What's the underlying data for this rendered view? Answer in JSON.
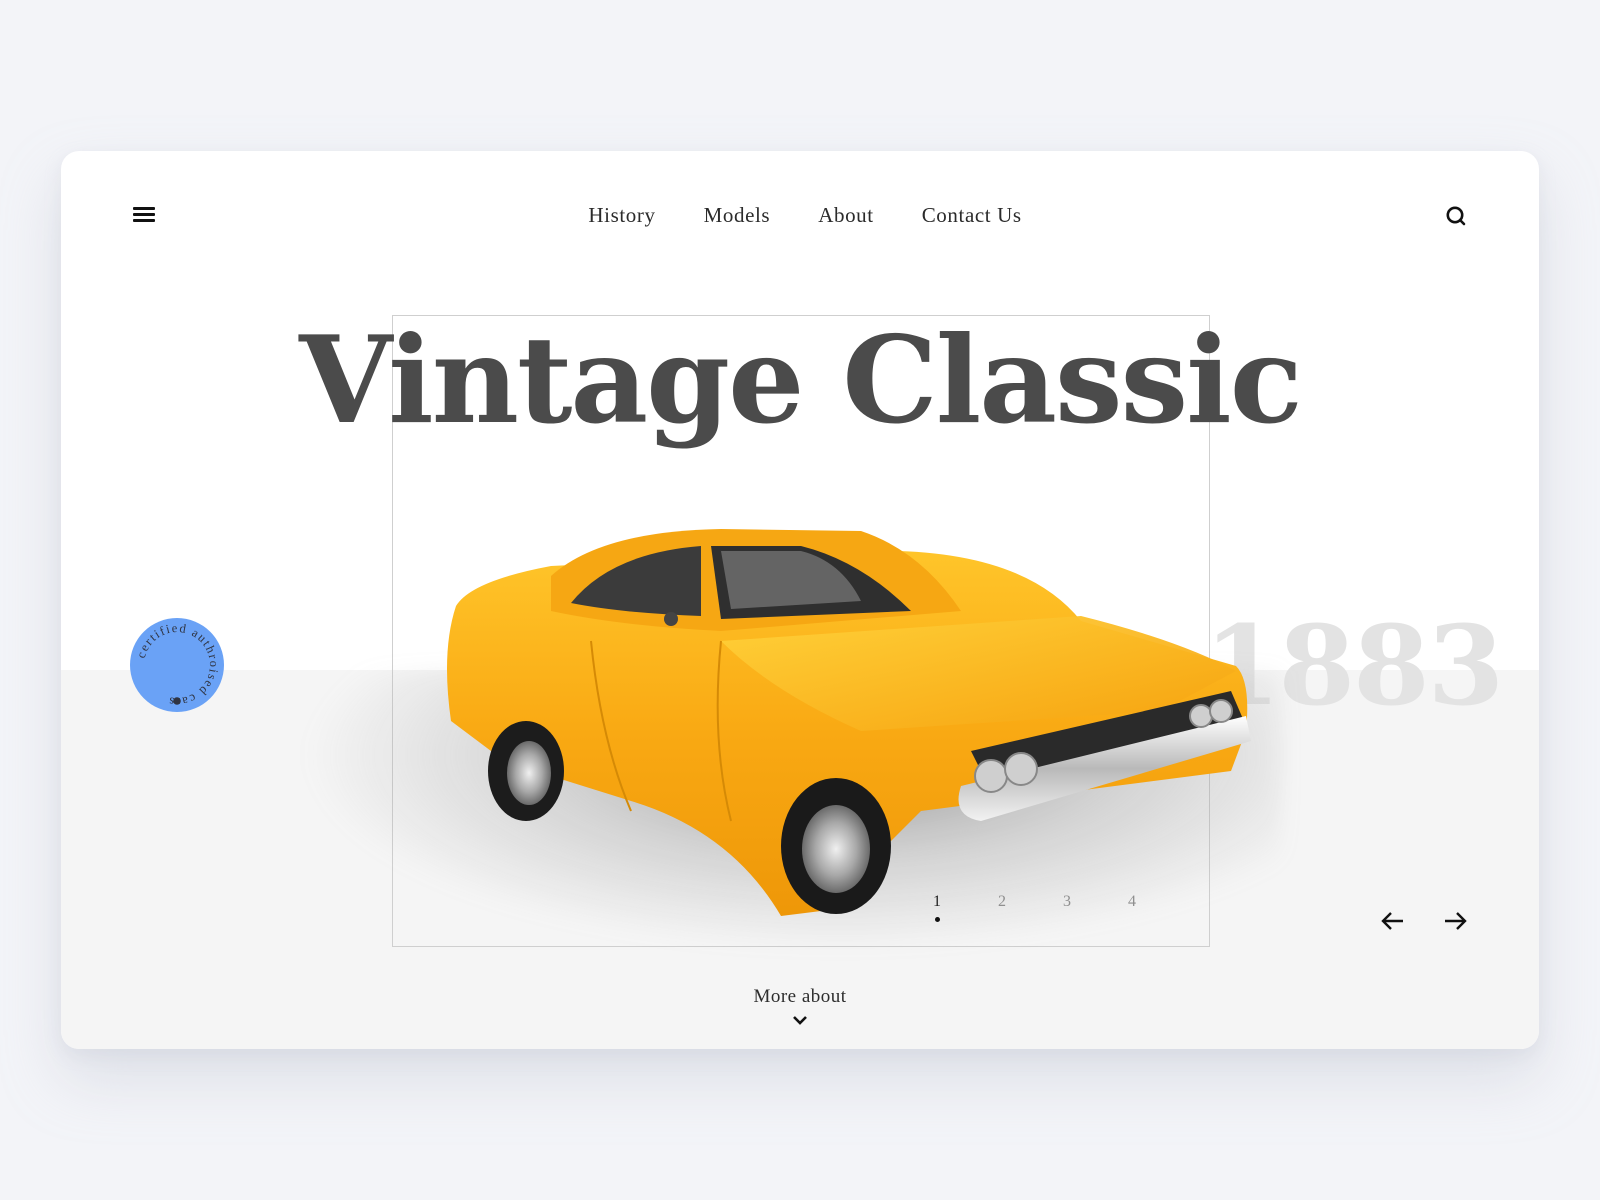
{
  "header": {
    "menu_icon": "hamburger-menu-icon",
    "nav": [
      {
        "label": "History"
      },
      {
        "label": "Models"
      },
      {
        "label": "About"
      },
      {
        "label": "Contact Us"
      }
    ],
    "search_icon": "search-icon"
  },
  "hero": {
    "title": "Vintage Classic",
    "year": "1883",
    "image": "yellow-classic-car",
    "badge": {
      "text": "certified authroised cars",
      "color": "#6aa2f6",
      "text_color": "#2f3442"
    }
  },
  "slider": {
    "pages": [
      "1",
      "2",
      "3",
      "4"
    ],
    "active_page": 1,
    "prev_icon": "arrow-left-icon",
    "next_icon": "arrow-right-icon"
  },
  "footer": {
    "more_label": "More about",
    "more_icon": "chevron-down-icon"
  },
  "colors": {
    "page_bg": "#f3f4f8",
    "card_bg": "#ffffff",
    "band_bg": "#f5f5f5",
    "title": "#4b4b4b",
    "year": "#e3e3e3",
    "car_body": "#f8a912"
  }
}
